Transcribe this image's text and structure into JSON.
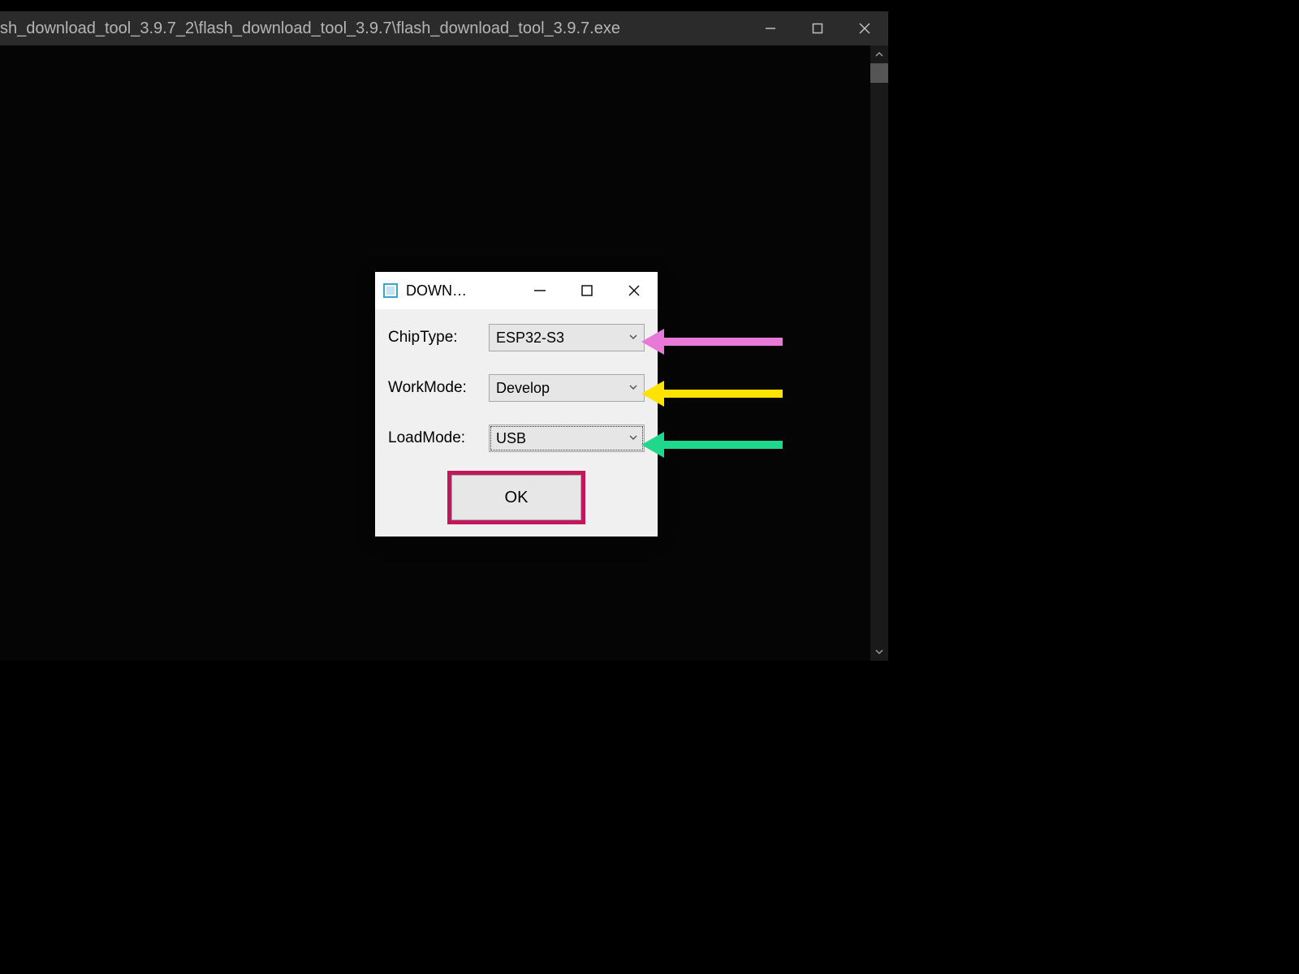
{
  "mainWindow": {
    "title": "sh_download_tool_3.9.7_2\\flash_download_tool_3.9.7\\flash_download_tool_3.9.7.exe"
  },
  "dialog": {
    "title": "DOWNL…",
    "fields": {
      "chipType": {
        "label": "ChipType:",
        "value": "ESP32-S3"
      },
      "workMode": {
        "label": "WorkMode:",
        "value": "Develop"
      },
      "loadMode": {
        "label": "LoadMode:",
        "value": "USB"
      }
    },
    "okLabel": "OK"
  },
  "annotations": {
    "arrow1_color": "#e879d9",
    "arrow2_color": "#fce303",
    "arrow3_color": "#1ed98b",
    "ok_highlight_color": "#c2185b"
  }
}
